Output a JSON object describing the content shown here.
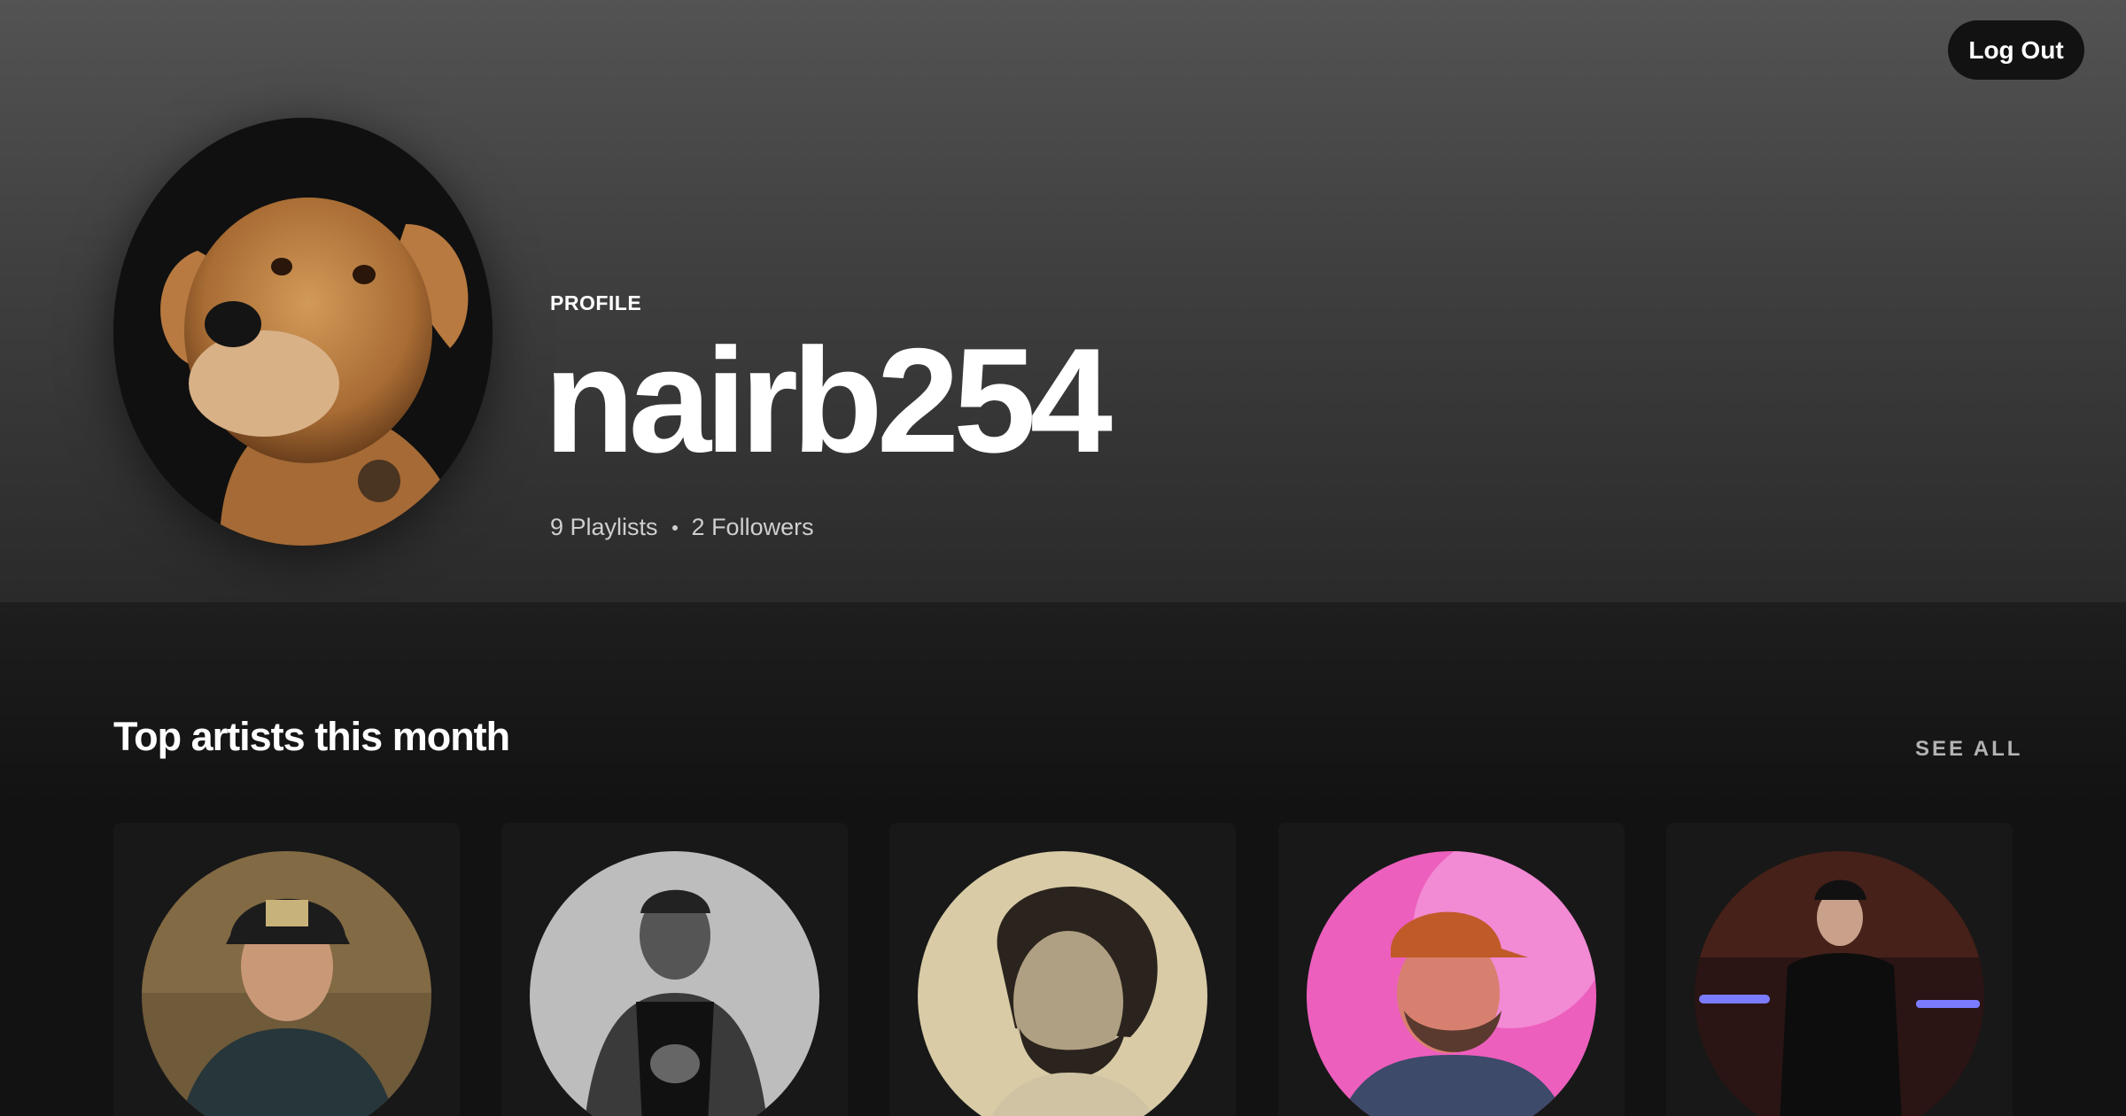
{
  "header": {
    "logout_label": "Log Out",
    "profile_kind": "PROFILE",
    "username": "nairb254",
    "playlists": "9 Playlists",
    "followers": "2 Followers"
  },
  "top_artists": {
    "title": "Top artists this month",
    "see_all_label": "SEE ALL",
    "artists": [
      {
        "bg": "#6f5a3a",
        "tone": "#3d2e20",
        "icon": "artist-photo-icon"
      },
      {
        "bg": "#bdbdbd",
        "tone": "#1a1a1a",
        "icon": "artist-photo-icon"
      },
      {
        "bg": "#d8cba6",
        "tone": "#3b332a",
        "icon": "artist-photo-icon"
      },
      {
        "bg": "#ec5fbd",
        "tone": "#5a3a2e",
        "icon": "artist-photo-icon"
      },
      {
        "bg": "#2a1414",
        "tone": "#0d0d0d",
        "icon": "artist-photo-icon"
      }
    ]
  },
  "colors": {
    "header_top": "#535353",
    "background": "#121212",
    "card": "#181818",
    "muted_text": "#b3b3b3"
  }
}
